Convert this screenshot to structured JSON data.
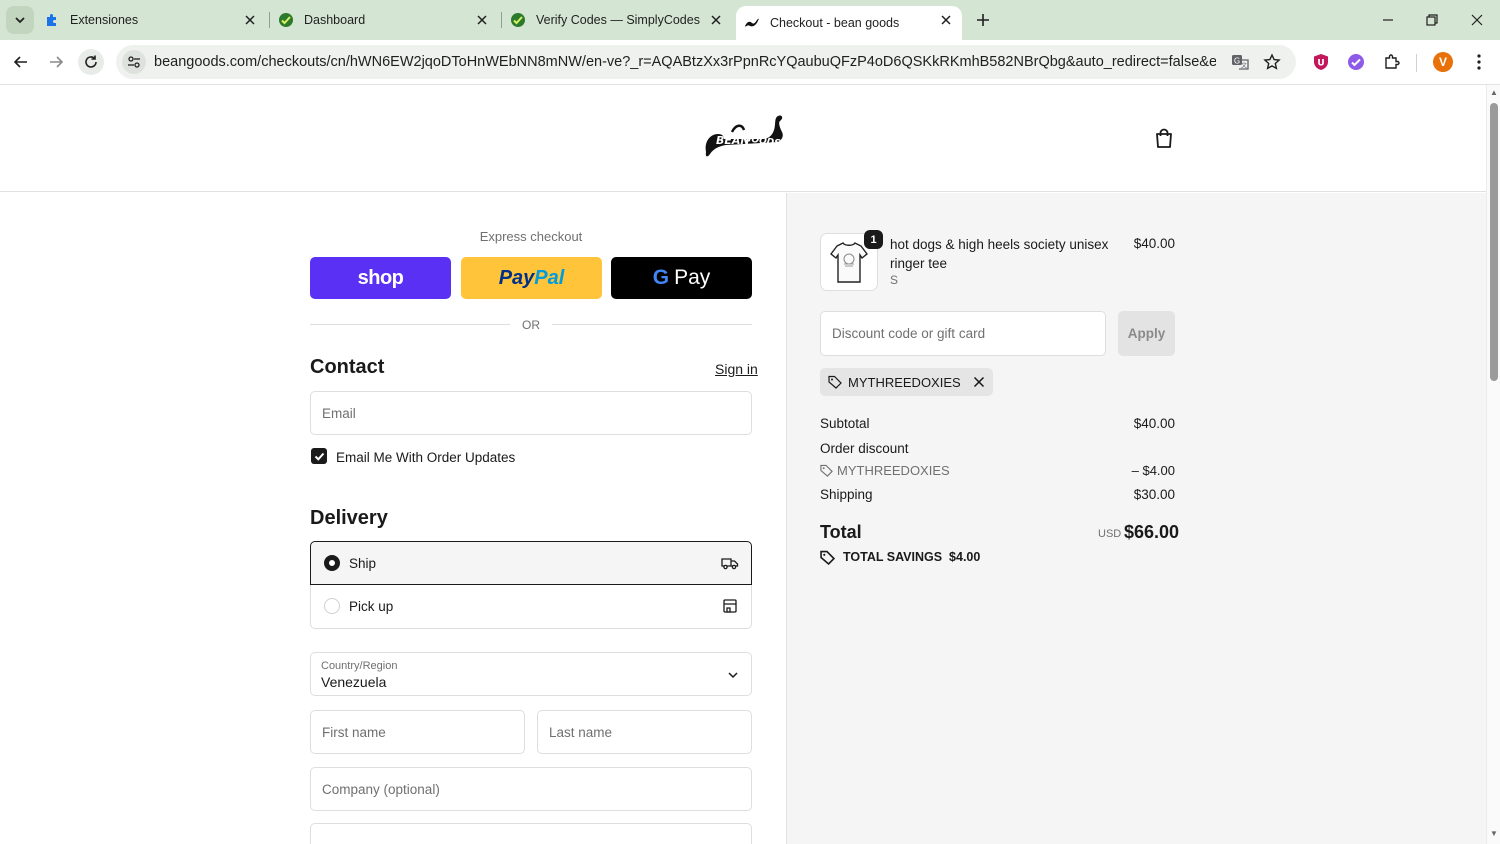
{
  "browser": {
    "tabs": [
      {
        "title": "Extensiones",
        "icon": "puzzle-icon"
      },
      {
        "title": "Dashboard",
        "icon": "simplycodes-icon"
      },
      {
        "title": "Verify Codes — SimplyCodes",
        "icon": "simplycodes-icon"
      },
      {
        "title": "Checkout - bean goods",
        "icon": "beangoods-icon",
        "active": true
      }
    ],
    "url": "beangoods.com/checkouts/cn/hWN6EW2jqoDToHnWEbNN8mNW/en-ve?_r=AQABtzXx3rPpnRcYQaubuQFzP4oD6QSKkRKmhB582NBrQbg&auto_redirect=false&edge_redirec...",
    "profile_initial": "V",
    "accent": "#d5e5d3"
  },
  "checkout": {
    "express_label": "Express checkout",
    "shop_label": "shop",
    "paypal_label_1": "Pay",
    "paypal_label_2": "Pal",
    "gpay_label": "Pay",
    "gpay_g": "G",
    "or_label": "OR",
    "contact_title": "Contact",
    "sign_in": "Sign in",
    "email_placeholder": "Email",
    "email_updates_label": "Email Me With Order Updates",
    "email_updates_checked": true,
    "delivery_title": "Delivery",
    "delivery_options": [
      {
        "label": "Ship",
        "selected": true
      },
      {
        "label": "Pick up",
        "selected": false
      }
    ],
    "country_label": "Country/Region",
    "country_value": "Venezuela",
    "first_name_placeholder": "First name",
    "last_name_placeholder": "Last name",
    "company_placeholder": "Company (optional)"
  },
  "summary": {
    "product": {
      "title": "hot dogs & high heels society unisex ringer tee",
      "variant": "S",
      "price": "$40.00",
      "quantity": "1"
    },
    "discount_placeholder": "Discount code or gift card",
    "apply_label": "Apply",
    "applied_code": "MYTHREEDOXIES",
    "subtotal_label": "Subtotal",
    "subtotal_value": "$40.00",
    "order_discount_label": "Order discount",
    "discount_code_line": "MYTHREEDOXIES",
    "discount_value": "– $4.00",
    "shipping_label": "Shipping",
    "shipping_value": "$30.00",
    "total_label": "Total",
    "total_currency": "USD",
    "total_value": "$66.00",
    "savings_label": "TOTAL SAVINGS",
    "savings_value": "$4.00"
  }
}
